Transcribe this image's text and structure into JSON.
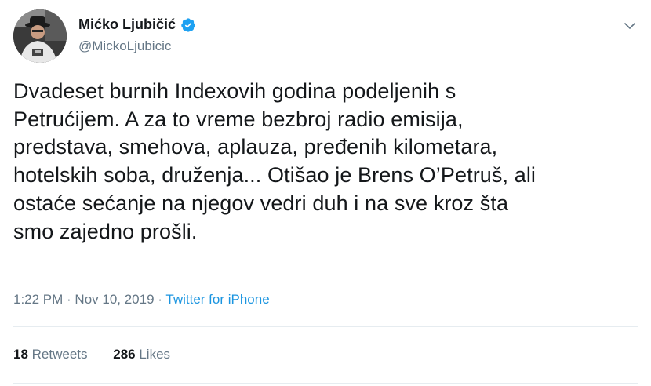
{
  "author": {
    "display_name": "Mićko Ljubičić",
    "handle": "@MickoLjubicic",
    "verified": true,
    "avatar_icon": "avatar-photo"
  },
  "tweet": {
    "text": "Dvadeset burnih Indexovih godina podeljenih s\nPetrućijem. A za to vreme bezbroj radio emisija,\npredstava, smehova, aplauza, pređenih kilometara,\nhotelskih soba, druženja... Otišao je Brens O’Petruš, ali\nostaće sećanje na njegov vedri duh i na sve kroz šta\nsmo zajedno prošli.",
    "time": "1:22 PM",
    "separator": " · ",
    "date": "Nov 10, 2019",
    "source": "Twitter for iPhone"
  },
  "stats": {
    "retweets_count": "18",
    "retweets_label": " Retweets",
    "likes_count": "286",
    "likes_label": " Likes"
  },
  "colors": {
    "text": "#14171a",
    "secondary": "#657786",
    "link": "#1b95e0",
    "verified": "#1da1f2",
    "divider": "#e6ecf0"
  },
  "icons": {
    "verified": "verified-badge-icon",
    "menu": "chevron-down-icon"
  }
}
